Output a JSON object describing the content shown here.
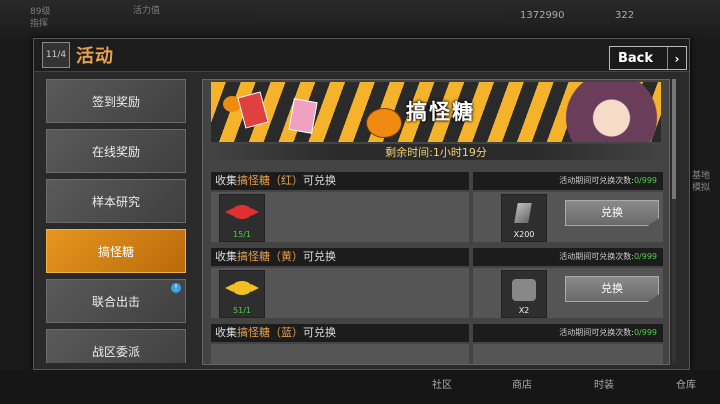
{
  "hud": {
    "level": "89级",
    "rank": "指挥",
    "activity_label": "活力值",
    "currency1": "1372990",
    "currency2": "322",
    "right_labels": [
      "基地",
      "模拟"
    ]
  },
  "panel": {
    "page_index": "11/4",
    "title": "活动",
    "back_label": "Back",
    "back_arrow": "›"
  },
  "sidebar": {
    "items": [
      {
        "label": "签到奖励",
        "active": false,
        "badge": false
      },
      {
        "label": "在线奖励",
        "active": false,
        "badge": false
      },
      {
        "label": "样本研究",
        "active": false,
        "badge": false
      },
      {
        "label": "搞怪糖",
        "active": true,
        "badge": false
      },
      {
        "label": "联合出击",
        "active": false,
        "badge": true
      },
      {
        "label": "战区委派",
        "active": false,
        "badge": false
      }
    ],
    "badge_glyph": "!"
  },
  "banner": {
    "title": "搞怪糖",
    "timer": "剩余时间:1小时19分"
  },
  "tasks": [
    {
      "prefix": "收集",
      "highlight": "搞怪糖（红）",
      "suffix": "可兑换",
      "limit_label": "活动期间可兑换次数:",
      "limit_count": "0/999",
      "candy_color": "#e03030",
      "item_count": "15/1",
      "reward_icon": "gem-icon",
      "reward_qty": "X200",
      "button_label": "兑换"
    },
    {
      "prefix": "收集",
      "highlight": "搞怪糖（黄）",
      "suffix": "可兑换",
      "limit_label": "活动期间可兑换次数:",
      "limit_count": "0/999",
      "candy_color": "#f0c020",
      "item_count": "51/1",
      "reward_icon": "robot-icon",
      "reward_qty": "X2",
      "button_label": "兑换"
    },
    {
      "prefix": "收集",
      "highlight": "搞怪糖（蓝）",
      "suffix": "可兑换",
      "limit_label": "活动期间可兑换次数:",
      "limit_count": "0/999"
    }
  ],
  "bottom_nav": [
    "社区",
    "商店",
    "时装",
    "仓库"
  ]
}
